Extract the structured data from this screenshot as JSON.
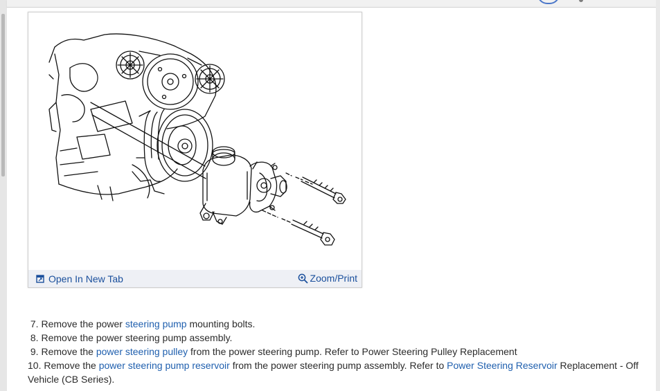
{
  "figure": {
    "open_tab_label": "Open In New Tab",
    "zoom_label": "Zoom/Print",
    "icons": {
      "open_tab": "open-in-new-tab-icon",
      "zoom": "zoom-in-icon"
    }
  },
  "steps": [
    {
      "number": "7.",
      "t1": "Remove the power ",
      "l1": "steering pump",
      "t2": " mounting bolts."
    },
    {
      "number": "8.",
      "t1": "Remove the power steering pump assembly."
    },
    {
      "number": "9.",
      "t1": "Remove the ",
      "l1": "power steering pulley",
      "t2": " from the power steering pump. Refer to Power Steering Pulley Replacement"
    },
    {
      "number": "10.",
      "t1": "Remove the ",
      "l1": "power steering pump reservoir",
      "t2": " from the power steering pump assembly. Refer to ",
      "l2": "Power Steering Reservoir",
      "t3": " Replacement - Off Vehicle (CB Series)."
    }
  ],
  "colors": {
    "link": "#1f5fae",
    "text": "#2b2b2b",
    "toolbar_bg": "#eef0f5"
  }
}
